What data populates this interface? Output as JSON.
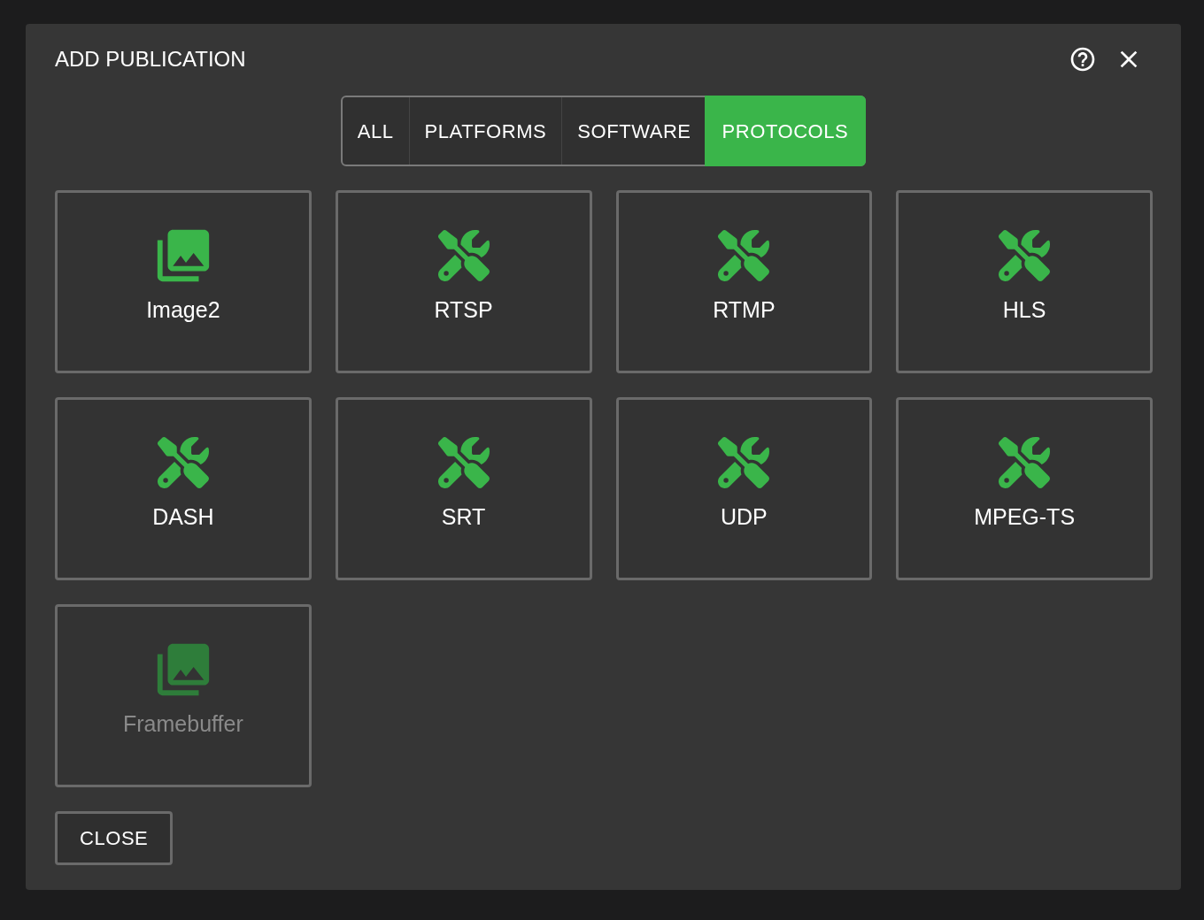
{
  "dialog": {
    "title": "ADD PUBLICATION"
  },
  "tabs": [
    {
      "label": "ALL",
      "selected": false
    },
    {
      "label": "PLATFORMS",
      "selected": false
    },
    {
      "label": "SOFTWARE",
      "selected": false
    },
    {
      "label": "PROTOCOLS",
      "selected": true
    }
  ],
  "items": [
    {
      "kind": "image",
      "label": "Image2",
      "disabled": false
    },
    {
      "kind": "tools",
      "label": "RTSP",
      "disabled": false
    },
    {
      "kind": "tools",
      "label": "RTMP",
      "disabled": false
    },
    {
      "kind": "tools",
      "label": "HLS",
      "disabled": false
    },
    {
      "kind": "tools",
      "label": "DASH",
      "disabled": false
    },
    {
      "kind": "tools",
      "label": "SRT",
      "disabled": false
    },
    {
      "kind": "tools",
      "label": "UDP",
      "disabled": false
    },
    {
      "kind": "tools",
      "label": "MPEG-TS",
      "disabled": false
    },
    {
      "kind": "image",
      "label": "Framebuffer",
      "disabled": true
    }
  ],
  "buttons": [
    "CLOSE"
  ]
}
